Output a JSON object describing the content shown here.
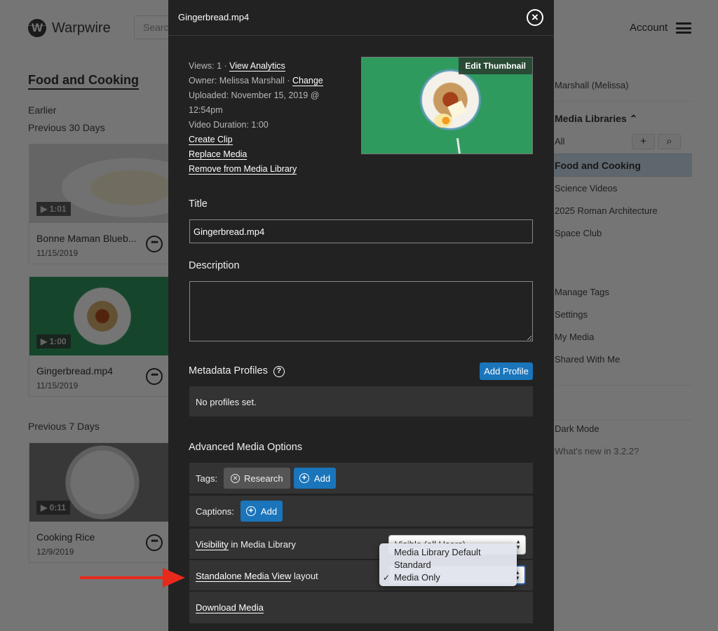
{
  "app": {
    "brand": "Warpwire",
    "search_placeholder": "Search",
    "account_label": "Account"
  },
  "library": {
    "title": "Food and Cooking",
    "sections": [
      {
        "label": "Earlier"
      },
      {
        "label": "Previous 30 Days"
      },
      {
        "label": "Previous 7 Days"
      }
    ],
    "cards": [
      {
        "title": "Bonne Maman Blueb...",
        "date": "11/15/2019",
        "duration": "▶ 1:01"
      },
      {
        "title": "Gingerbread.mp4",
        "date": "11/15/2019",
        "duration": "▶ 1:00"
      },
      {
        "title": "Cooking Rice",
        "date": "12/9/2019",
        "duration": "▶ 0:11"
      }
    ]
  },
  "sidebar": {
    "user": "Marshall (Melissa)",
    "libraries_heading": "Media Libraries",
    "all_label": "All",
    "add_icon": "+",
    "items": [
      {
        "label": "Food and Cooking",
        "selected": true
      },
      {
        "label": "Science Videos"
      },
      {
        "label": "2025 Roman Architecture"
      },
      {
        "label": "Space Club"
      }
    ],
    "links": [
      {
        "label": "Manage Tags"
      },
      {
        "label": "Settings"
      },
      {
        "label": "My Media"
      },
      {
        "label": "Shared With Me"
      }
    ],
    "dark_mode_label": "Dark Mode",
    "whats_new": "What's new in 3.2.2?"
  },
  "modal": {
    "title": "Gingerbread.mp4",
    "close_icon": "×",
    "meta": {
      "views_label": "Views: 1 · ",
      "view_analytics": "View Analytics",
      "owner_label": "Owner: Melissa Marshall · ",
      "change": "Change",
      "uploaded_line1": "Uploaded: November 15, 2019 @",
      "uploaded_line2": "12:54pm",
      "duration": "Video Duration: 1:00",
      "create_clip": "Create Clip",
      "replace_media": "Replace Media",
      "remove": "Remove from Media Library"
    },
    "edit_thumbnail": "Edit Thumbnail",
    "title_label": "Title",
    "title_value": "Gingerbread.mp4",
    "description_label": "Description",
    "description_value": "",
    "metadata_label": "Metadata Profiles",
    "help_icon": "?",
    "add_profile": "Add Profile",
    "no_profiles": "No profiles set.",
    "advanced_label": "Advanced Media Options",
    "tags_label": "Tags:",
    "tags": [
      {
        "label": "Research"
      }
    ],
    "add_label": "Add",
    "captions_label": "Captions:",
    "visibility_link": "Visibility",
    "visibility_rest": " in Media Library",
    "visibility_value": "Visible (all Users)",
    "layout_link": "Standalone Media View",
    "layout_rest": " layout",
    "layout_value": "Media Only",
    "layout_options": [
      {
        "label": "Media Library Default",
        "checked": false
      },
      {
        "label": "Standard",
        "checked": false
      },
      {
        "label": "Media Only",
        "checked": true
      }
    ],
    "check_mark": "✓",
    "download": "Download Media"
  },
  "annotation": {
    "arrow_color": "#e8291c"
  },
  "colors": {
    "accent": "#1a75bb",
    "modal_bg": "#222222",
    "panel_bg": "#333333"
  }
}
